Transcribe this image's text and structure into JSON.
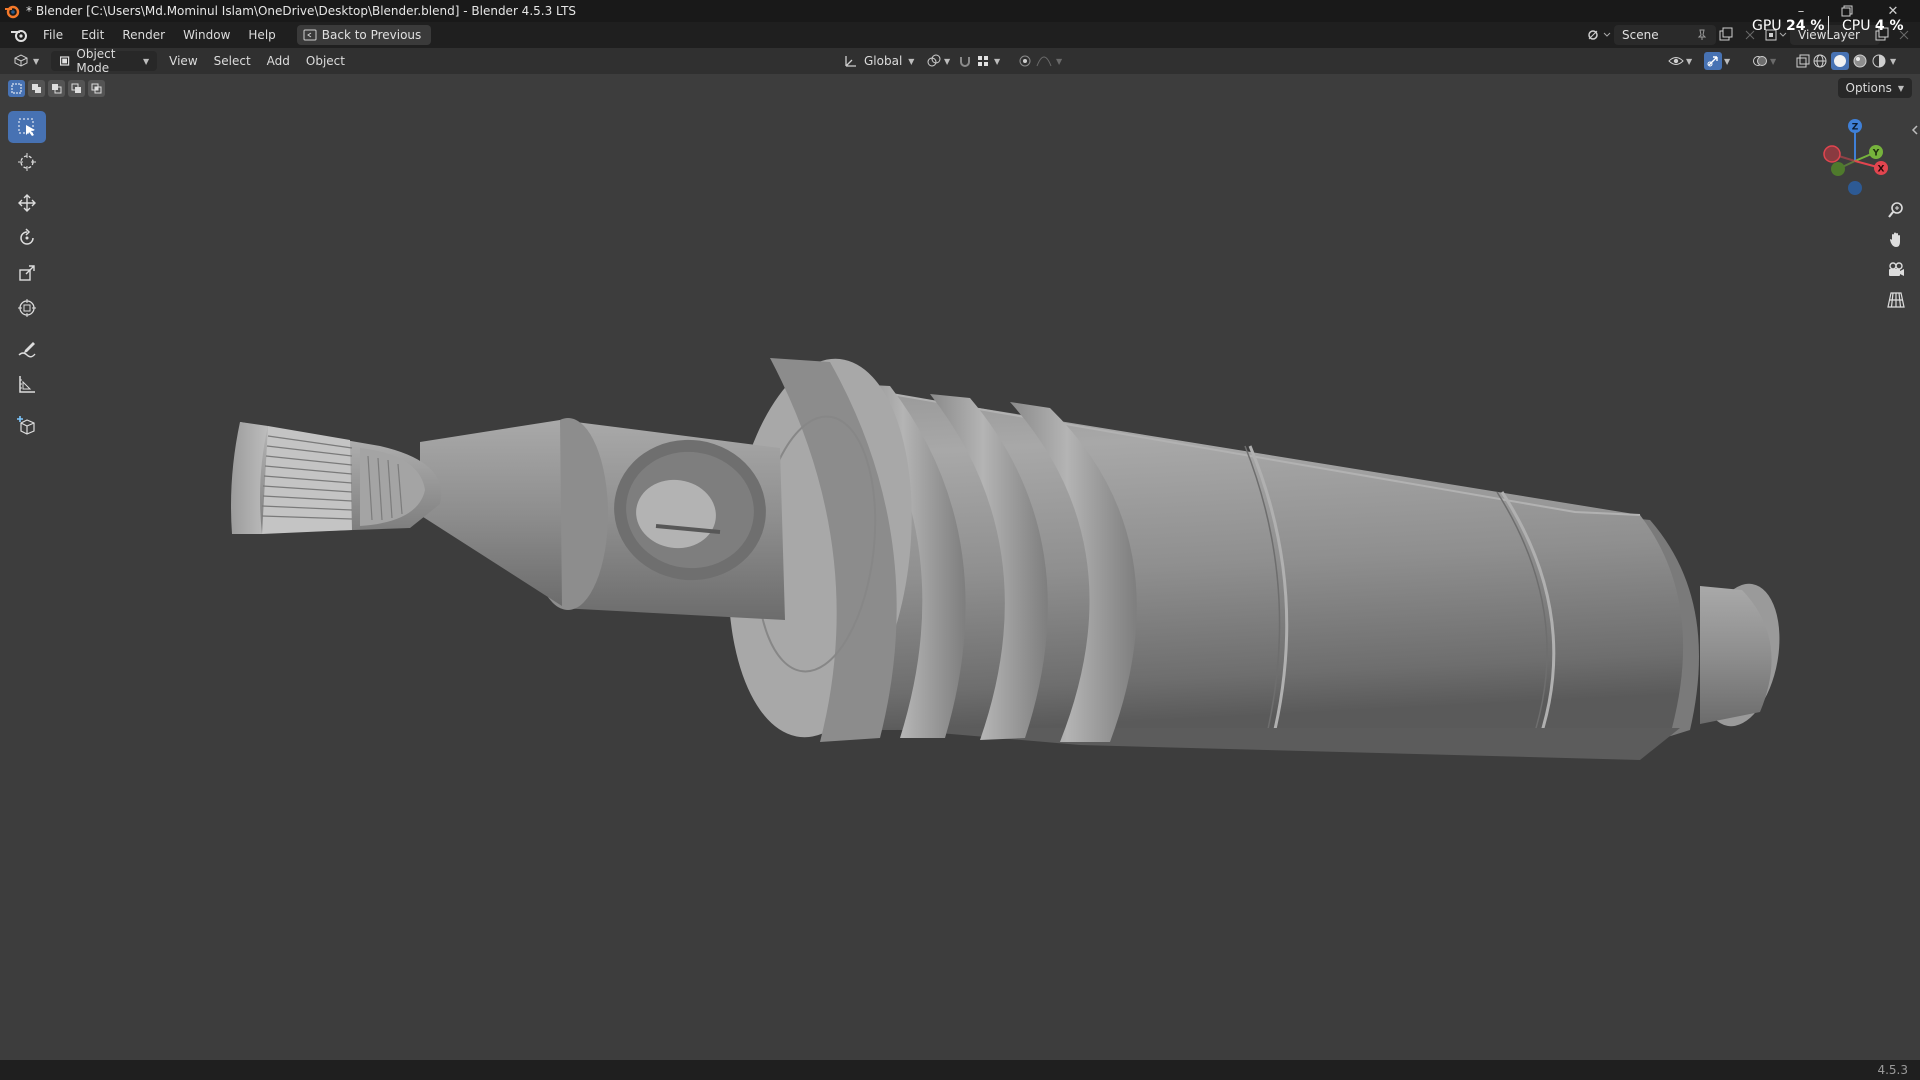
{
  "window": {
    "title": "* Blender [C:\\Users\\Md.Mominul Islam\\OneDrive\\Desktop\\Blender.blend] - Blender 4.5.3 LTS",
    "controls": [
      "minimize-icon",
      "restore-icon",
      "close-icon"
    ]
  },
  "menubar": {
    "items": [
      "File",
      "Edit",
      "Render",
      "Window",
      "Help"
    ],
    "back_button": "Back to Previous",
    "scene": "Scene",
    "view_layer": "ViewLayer",
    "gpu_label": "GPU",
    "gpu_value": "24 %",
    "cpu_label": "CPU",
    "cpu_value": "4 %"
  },
  "header": {
    "mode": "Object Mode",
    "menus": [
      "View",
      "Select",
      "Add",
      "Object"
    ],
    "transform_orientation": "Global"
  },
  "viewport": {
    "options_label": "Options",
    "selection_modes": [
      "select-set-icon",
      "select-extend-icon",
      "select-subtract-icon",
      "select-difference-icon",
      "select-intersect-icon"
    ],
    "tools": [
      "select-box-icon",
      "cursor-icon",
      "move-icon",
      "rotate-icon",
      "scale-icon",
      "transform-icon",
      "annotate-icon",
      "measure-icon",
      "add-cube-icon"
    ],
    "nav_buttons": [
      "zoom-icon",
      "pan-hand-icon",
      "camera-view-icon",
      "perspective-grid-icon"
    ],
    "gizmo_axes": [
      "X",
      "Y",
      "Z"
    ],
    "colors": {
      "background": "#3d3d3d",
      "active": "#4772b3",
      "x_axis": "#e2454f",
      "y_axis": "#76b33c",
      "z_axis": "#3f80d8"
    }
  },
  "statusbar": {
    "version": "4.5.3"
  }
}
